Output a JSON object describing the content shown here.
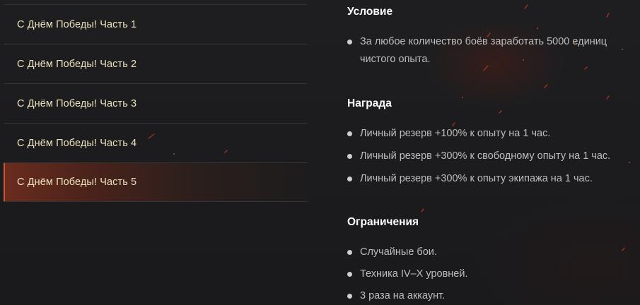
{
  "sidebar": {
    "items": [
      {
        "label": "С Днём Победы! Часть 1"
      },
      {
        "label": "С Днём Победы! Часть 2"
      },
      {
        "label": "С Днём Победы! Часть 3"
      },
      {
        "label": "С Днём Победы! Часть 4"
      },
      {
        "label": "С Днём Победы! Часть 5"
      }
    ],
    "active_index": 4
  },
  "content": {
    "condition": {
      "title": "Условие",
      "items": [
        "За любое количество боёв заработать 5000 единиц чистого опыта."
      ]
    },
    "reward": {
      "title": "Награда",
      "items": [
        "Личный резерв +100% к опыту на 1 час.",
        "Личный резерв +300% к свободному опыту на 1 час.",
        "Личный резерв +300% к опыту экипажа на 1 час."
      ]
    },
    "restrictions": {
      "title": "Ограничения",
      "items": [
        "Случайные бои.",
        "Техника IV–X уровней.",
        "3 раза на аккаунт."
      ]
    }
  },
  "colors": {
    "background": "#1c1c1e",
    "accent": "#d3552d",
    "sidebar_text": "#ece1bd",
    "heading": "#ffffff",
    "body_text": "#bdbdbd"
  }
}
